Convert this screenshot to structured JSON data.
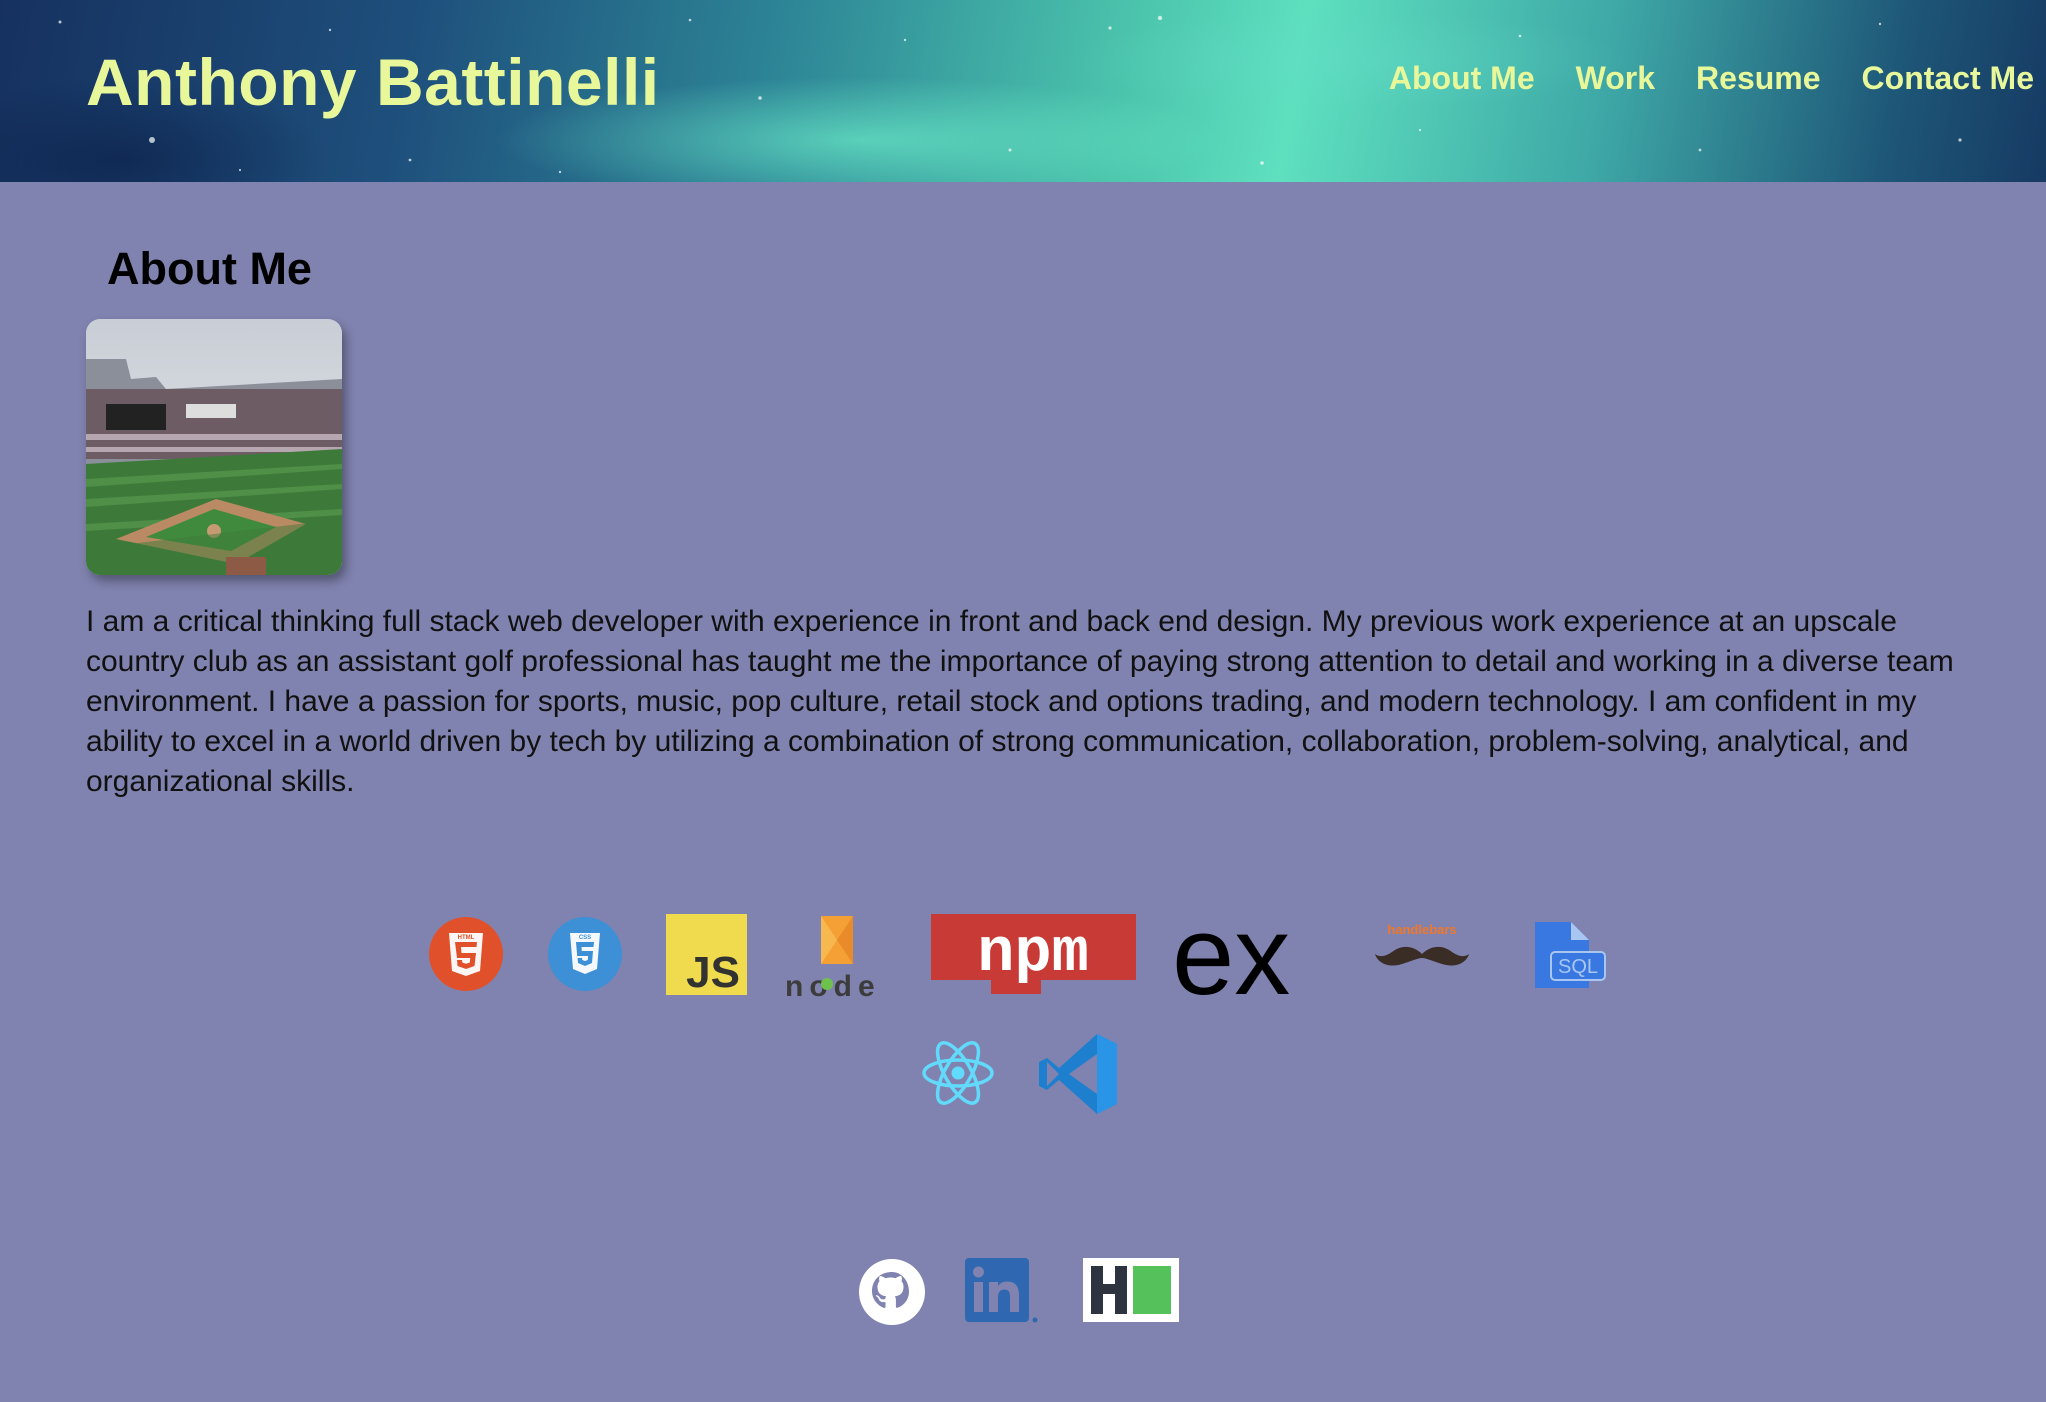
{
  "header": {
    "title": "Anthony Battinelli",
    "nav": [
      "About Me",
      "Work",
      "Resume",
      "Contact Me"
    ]
  },
  "about": {
    "heading": "About Me",
    "bio": "I am a critical thinking full stack web developer with experience in front and back end design. My previous work experience at an upscale country club as an assistant golf professional has taught me the importance of paying strong attention to detail and working in a diverse team environment. I have a passion for sports, music, pop culture, retail stock and options trading, and modern technology. I am confident in my ability to excel in a world driven by tech by utilizing a combination of strong communication, collaboration, problem-solving, analytical, and organizational skills."
  },
  "tech_icons": {
    "html": "HTML",
    "css": "CSS",
    "js": "JS",
    "node": "node",
    "npm": "npm",
    "express": "ex",
    "handlebars": "handlebars",
    "sql": "SQL"
  },
  "colors": {
    "background": "#8083af",
    "title": "#e9f79b",
    "html": "#e0512b",
    "css": "#3d8fd6",
    "js": "#f0db4f",
    "npm": "#c83a36",
    "react": "#61dafb",
    "vscode": "#2a8fd6"
  },
  "social_icons": [
    "github-icon",
    "linkedin-icon",
    "hackerrank-icon"
  ]
}
